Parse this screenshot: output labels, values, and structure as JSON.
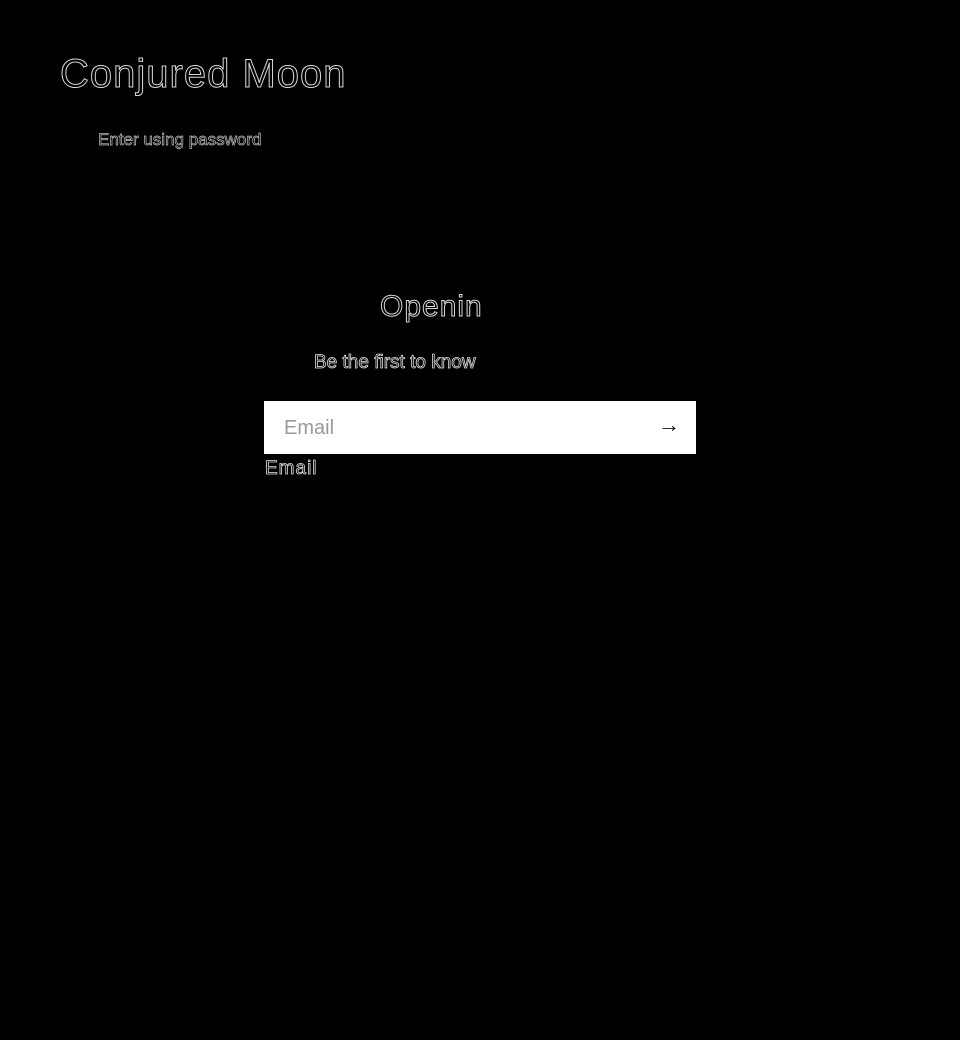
{
  "header": {
    "store_name": "Conjured Moon",
    "password_link": "Enter using password"
  },
  "main": {
    "heading": "Opening",
    "subheading": "Be the first to know",
    "email_field": {
      "placeholder": "Email",
      "value": "",
      "label": "Email"
    },
    "submit_icon": "arrow-right-icon"
  }
}
